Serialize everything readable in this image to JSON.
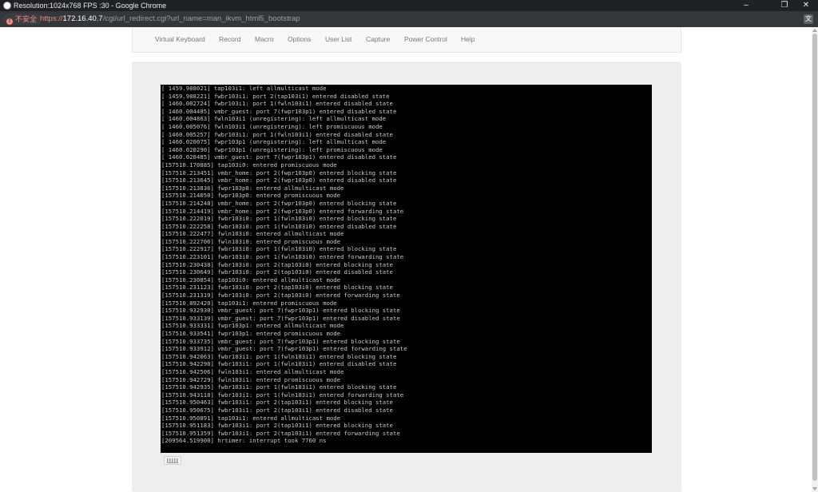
{
  "window": {
    "title": "Resolution:1024x768 FPS :30 - Google Chrome",
    "controls": [
      "–",
      "❐",
      "✕"
    ]
  },
  "address_bar": {
    "security_label": "不安全",
    "url_scheme": "https://",
    "url_host": "172.16.40.7",
    "url_path": "/cgi/url_redirect.cgi?url_name=man_ikvm_html5_bootstrap",
    "translate_icon": "translate-icon"
  },
  "navbar": {
    "items": [
      {
        "label": "Virtual Keyboard"
      },
      {
        "label": "Record"
      },
      {
        "label": "Macro"
      },
      {
        "label": "Options"
      },
      {
        "label": "User List"
      },
      {
        "label": "Capture"
      },
      {
        "label": "Power Control"
      },
      {
        "label": "Help"
      }
    ]
  },
  "console": {
    "lines": [
      "[ 1459.988021] tap103i1: left allmulticast mode",
      "[ 1459.988221] fwbr103i1: port 2(tap103i1) entered disabled state",
      "[ 1460.002724] fwbr103i1: port 1(fwln103i1) entered disabled state",
      "[ 1460.004485] vmbr_guest: port 7(fwpr103p1) entered disabled state",
      "[ 1460.004863] fwln103i1 (unregistering): left allmulticast mode",
      "[ 1460.005076] fwln103i1 (unregistering): left promiscuous mode",
      "[ 1460.005257] fwbr103i1: port 1(fwln103i1) entered disabled state",
      "[ 1460.020075] fwpr103p1 (unregistering): left allmulticast mode",
      "[ 1460.020290] fwpr103p1 (unregistering): left promiscuous mode",
      "[ 1460.020485] vmbr_guest: port 7(fwpr103p1) entered disabled state",
      "[157510.170885] tap103i0: entered promiscuous mode",
      "[157510.213451] vmbr_home: port 2(fwpr103p0) entered blocking state",
      "[157510.213645] vmbr_home: port 2(fwpr103p0) entered disabled state",
      "[157510.213836] fwpr103p0: entered allmulticast mode",
      "[157510.214050] fwpr103p0: entered promiscuous mode",
      "[157510.214248] vmbr_home: port 2(fwpr103p0) entered blocking state",
      "[157510.214419] vmbr_home: port 2(fwpr103p0) entered forwarding state",
      "[157510.222019] fwbr103i0: port 1(fwln103i0) entered blocking state",
      "[157510.222258] fwbr103i0: port 1(fwln103i0) entered disabled state",
      "[157510.222477] fwln103i0: entered allmulticast mode",
      "[157510.222706] fwln103i0: entered promiscuous mode",
      "[157510.222917] fwbr103i0: port 1(fwln103i0) entered blocking state",
      "[157510.223101] fwbr103i0: port 1(fwln103i0) entered forwarding state",
      "[157510.230438] fwbr103i0: port 2(tap103i0) entered blocking state",
      "[157510.230649] fwbr103i0: port 2(tap103i0) entered disabled state",
      "[157510.230854] tap103i0: entered allmulticast mode",
      "[157510.231123] fwbr103i0: port 2(tap103i0) entered blocking state",
      "[157510.231319] fwbr103i0: port 2(tap103i0) entered forwarding state",
      "[157510.892420] tap103i1: entered promiscuous mode",
      "[157510.932930] vmbr_guest: port 7(fwpr103p1) entered blocking state",
      "[157510.933139] vmbr_guest: port 7(fwpr103p1) entered disabled state",
      "[157510.933331] fwpr103p1: entered allmulticast mode",
      "[157510.933541] fwpr103p1: entered promiscuous mode",
      "[157510.933735] vmbr_guest: port 7(fwpr103p1) entered blocking state",
      "[157510.933912] vmbr_guest: port 7(fwpr103p1) entered forwarding state",
      "[157510.942063] fwbr103i1: port 1(fwln103i1) entered blocking state",
      "[157510.942290] fwbr103i1: port 1(fwln103i1) entered disabled state",
      "[157510.942506] fwln103i1: entered allmulticast mode",
      "[157510.942729] fwln103i1: entered promiscuous mode",
      "[157510.942935] fwbr103i1: port 1(fwln103i1) entered blocking state",
      "[157510.943118] fwbr103i1: port 1(fwln103i1) entered forwarding state",
      "[157510.950463] fwbr103i1: port 2(tap103i1) entered blocking state",
      "[157510.950675] fwbr103i1: port 2(tap103i1) entered disabled state",
      "[157510.950891] tap103i1: entered allmulticast mode",
      "[157510.951183] fwbr103i1: port 2(tap103i1) entered blocking state",
      "[157510.951359] fwbr103i1: port 2(tap103i1) entered forwarding state",
      "[209564.519900] hrtimer: interrupt took 7760 ns"
    ]
  },
  "keyboard_button": {
    "icon": "keyboard-icon"
  }
}
